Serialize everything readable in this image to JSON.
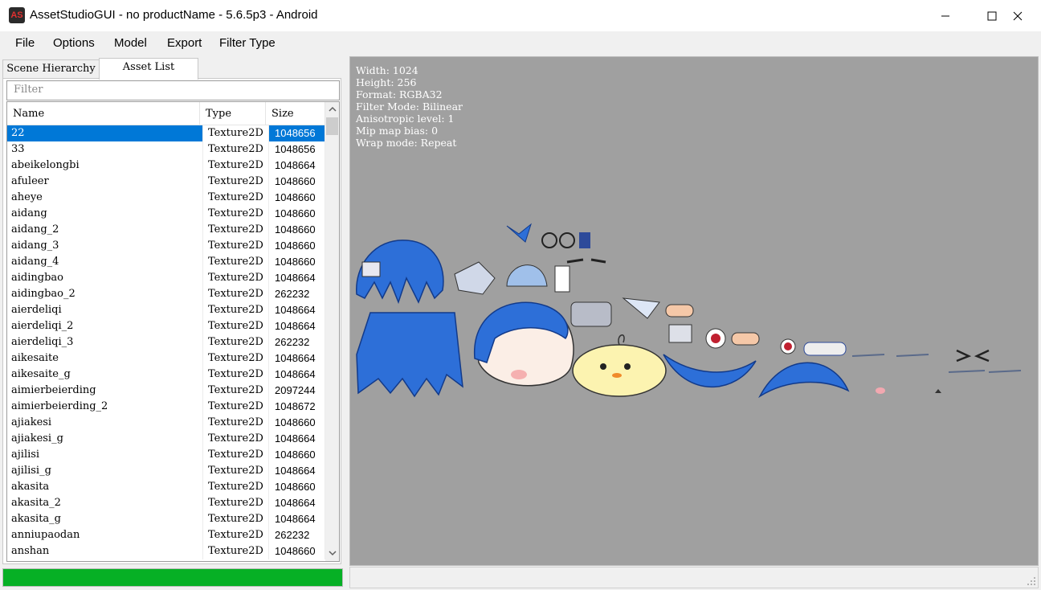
{
  "window": {
    "title": "AssetStudioGUI - no productName - 5.6.5p3 - Android",
    "icon_label": "AS"
  },
  "menu": [
    "File",
    "Options",
    "Model",
    "Export",
    "Filter Type"
  ],
  "tabs": [
    "Scene Hierarchy",
    "Asset List"
  ],
  "active_tab": "Asset List",
  "filter": {
    "placeholder": "Filter"
  },
  "table": {
    "headers": [
      "Name",
      "Type",
      "Size"
    ],
    "rows": [
      {
        "name": "22",
        "type": "Texture2D",
        "size": "1048656",
        "selected": true
      },
      {
        "name": "33",
        "type": "Texture2D",
        "size": "1048656"
      },
      {
        "name": "abeikelongbi",
        "type": "Texture2D",
        "size": "1048664"
      },
      {
        "name": "afuleer",
        "type": "Texture2D",
        "size": "1048660"
      },
      {
        "name": "aheye",
        "type": "Texture2D",
        "size": "1048660"
      },
      {
        "name": "aidang",
        "type": "Texture2D",
        "size": "1048660"
      },
      {
        "name": "aidang_2",
        "type": "Texture2D",
        "size": "1048660"
      },
      {
        "name": "aidang_3",
        "type": "Texture2D",
        "size": "1048660"
      },
      {
        "name": "aidang_4",
        "type": "Texture2D",
        "size": "1048660"
      },
      {
        "name": "aidingbao",
        "type": "Texture2D",
        "size": "1048664"
      },
      {
        "name": "aidingbao_2",
        "type": "Texture2D",
        "size": "262232"
      },
      {
        "name": "aierdeliqi",
        "type": "Texture2D",
        "size": "1048664"
      },
      {
        "name": "aierdeliqi_2",
        "type": "Texture2D",
        "size": "1048664"
      },
      {
        "name": "aierdeliqi_3",
        "type": "Texture2D",
        "size": "262232"
      },
      {
        "name": "aikesaite",
        "type": "Texture2D",
        "size": "1048664"
      },
      {
        "name": "aikesaite_g",
        "type": "Texture2D",
        "size": "1048664"
      },
      {
        "name": "aimierbeierding",
        "type": "Texture2D",
        "size": "2097244"
      },
      {
        "name": "aimierbeierding_2",
        "type": "Texture2D",
        "size": "1048672"
      },
      {
        "name": "ajiakesi",
        "type": "Texture2D",
        "size": "1048660"
      },
      {
        "name": "ajiakesi_g",
        "type": "Texture2D",
        "size": "1048664"
      },
      {
        "name": "ajilisi",
        "type": "Texture2D",
        "size": "1048660"
      },
      {
        "name": "ajilisi_g",
        "type": "Texture2D",
        "size": "1048664"
      },
      {
        "name": "akasita",
        "type": "Texture2D",
        "size": "1048660"
      },
      {
        "name": "akasita_2",
        "type": "Texture2D",
        "size": "1048664"
      },
      {
        "name": "akasita_g",
        "type": "Texture2D",
        "size": "1048664"
      },
      {
        "name": "anniupaodan",
        "type": "Texture2D",
        "size": "262232"
      },
      {
        "name": "anshan",
        "type": "Texture2D",
        "size": "1048660"
      }
    ]
  },
  "progress": {
    "fraction": 1.0,
    "color": "#06b025"
  },
  "preview": {
    "info_lines": [
      "Width: 1024",
      "Height: 256",
      "Format: RGBA32",
      "Filter Mode: Bilinear",
      "Anisotropic level: 1",
      "Mip map bias: 0",
      "Wrap mode: Repeat"
    ],
    "background": "#a0a0a0"
  },
  "colors": {
    "selection": "#0078d7",
    "accent_blue": "#2a6fd6"
  }
}
